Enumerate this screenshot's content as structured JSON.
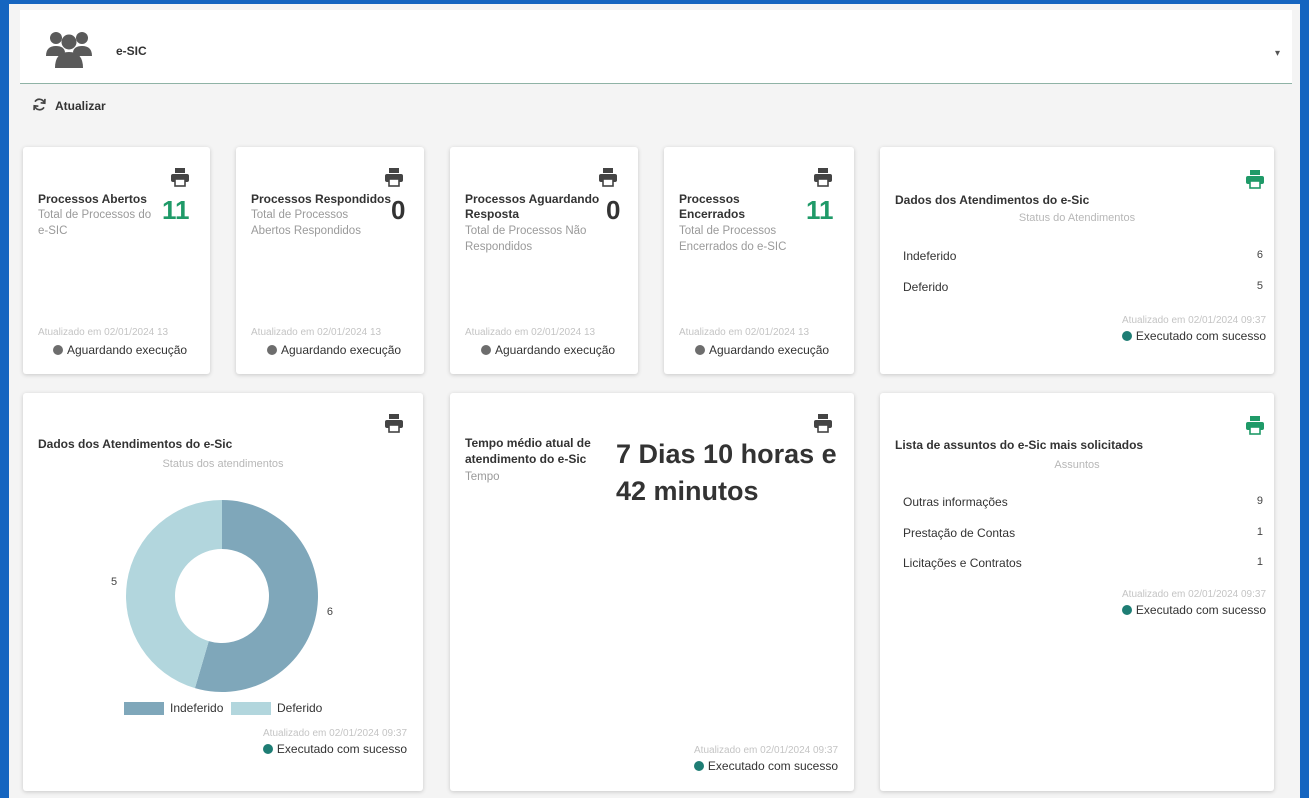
{
  "header": {
    "title": "e-SIC",
    "logo_icon": "users-group-icon",
    "caret": "▾"
  },
  "toolbar": {
    "refresh_label": "Atualizar",
    "refresh_icon": "refresh-icon"
  },
  "colors": {
    "green": "#1f9a68",
    "status_gray": "#6d6d6d",
    "status_teal": "#1e7d74",
    "donut_dark": "#7fa7ba",
    "donut_light": "#b2d6dd"
  },
  "kpi_cards": [
    {
      "title": "Processos Abertos",
      "subtitle": "Total de Processos do e-SIC",
      "value": "11",
      "updated": "Atualizado em 02/01/2024 13",
      "status": "Aguardando execução"
    },
    {
      "title": "Processos Respondidos",
      "subtitle": "Total de Processos Abertos Respondidos",
      "value": "0",
      "updated": "Atualizado em 02/01/2024 13",
      "status": "Aguardando execução"
    },
    {
      "title": "Processos Aguardando Resposta",
      "subtitle": "Total de Processos Não Respondidos",
      "value": "0",
      "updated": "Atualizado em 02/01/2024 13",
      "status": "Aguardando execução"
    },
    {
      "title": "Processos Encerrados",
      "subtitle": "Total de Processos Encerrados do e-SIC",
      "value": "11",
      "updated": "Atualizado em 02/01/2024 13",
      "status": "Aguardando execução"
    }
  ],
  "status_card": {
    "title": "Dados dos Atendimentos do e-Sic",
    "subtitle": "Status do Atendimentos",
    "rows": [
      {
        "label": "Indeferido",
        "value": "6"
      },
      {
        "label": "Deferido",
        "value": "5"
      }
    ],
    "updated": "Atualizado em 02/01/2024 09:37",
    "status": "Executado com sucesso"
  },
  "chart_card": {
    "title": "Dados dos Atendimentos do e-Sic",
    "subtitle": "Status dos atendimentos",
    "updated": "Atualizado em 02/01/2024 09:37",
    "status": "Executado com sucesso"
  },
  "chart_data": {
    "type": "pie",
    "categories": [
      "Indeferido",
      "Deferido"
    ],
    "values": [
      6,
      5
    ],
    "title": "Dados dos Atendimentos do e-Sic",
    "subtitle": "Status dos atendimentos",
    "legend": "bottom"
  },
  "time_card": {
    "title": "Tempo médio atual de atendimento do e-Sic",
    "subtitle": "Tempo",
    "value_line1": "7 Dias 10 horas e",
    "value_line2": "42 minutos",
    "updated": "Atualizado em 02/01/2024 09:37",
    "status": "Executado com sucesso"
  },
  "subjects_card": {
    "title": "Lista de assuntos do e-Sic mais solicitados",
    "subtitle": "Assuntos",
    "rows": [
      {
        "label": "Outras informações",
        "value": "9"
      },
      {
        "label": "Prestação de Contas",
        "value": "1"
      },
      {
        "label": "Licitações e Contratos",
        "value": "1"
      }
    ],
    "updated": "Atualizado em 02/01/2024 09:37",
    "status": "Executado com sucesso"
  }
}
